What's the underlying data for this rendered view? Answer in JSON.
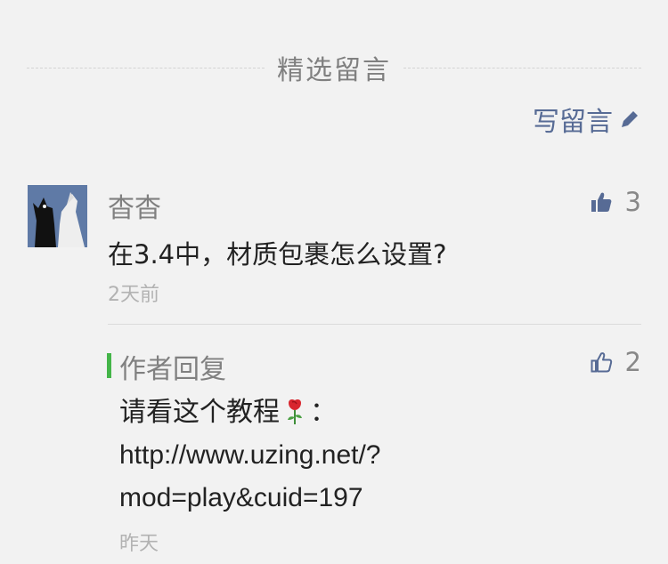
{
  "section": {
    "title": "精选留言"
  },
  "write_comment": {
    "label": "写留言",
    "icon": "pencil-icon"
  },
  "comment": {
    "nickname": "杳杳",
    "text": "在3.4中，材质包裹怎么设置?",
    "time": "2天前",
    "likes": "3",
    "like_icon": "thumbs-up-filled-icon",
    "avatar": "cat-avatar"
  },
  "reply": {
    "label": "作者回复",
    "line1": "请看这个教程",
    "line1_suffix": "：",
    "line2": "http://www.uzing.net/?",
    "line3": "mod=play&cuid=197",
    "emoji": "rose-emoji",
    "time": "昨天",
    "likes": "2",
    "like_icon": "thumbs-up-outline-icon"
  },
  "colors": {
    "link": "#576b95",
    "accent_green": "#44b549",
    "muted": "#808080",
    "text": "#222222",
    "time": "#b2b2b2"
  }
}
